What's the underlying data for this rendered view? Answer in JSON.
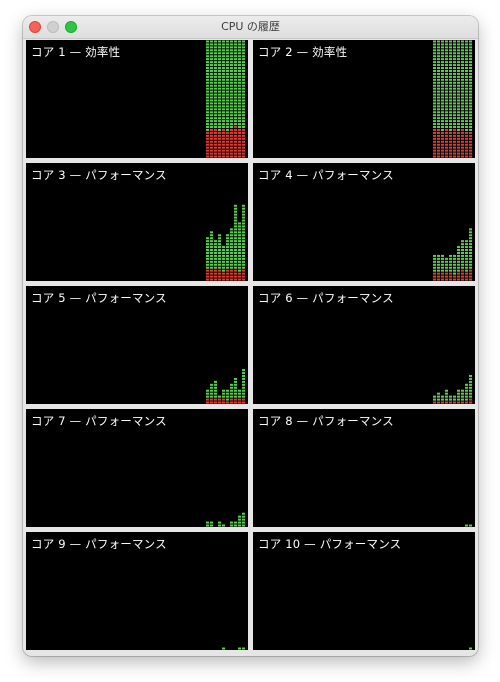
{
  "window": {
    "title": "CPU の履歴"
  },
  "colors": {
    "background": "#000000",
    "user_load": "#58d14a",
    "system_load": "#e33b2f",
    "label_text": "#ffffff"
  },
  "cores": [
    {
      "label": "コア 1 — 効率性",
      "history": [
        {
          "system": 0.23,
          "user": 0.77
        },
        {
          "system": 0.25,
          "user": 0.75
        },
        {
          "system": 0.24,
          "user": 0.76
        },
        {
          "system": 0.23,
          "user": 0.77
        },
        {
          "system": 0.25,
          "user": 0.75
        },
        {
          "system": 0.23,
          "user": 0.77
        },
        {
          "system": 0.24,
          "user": 0.76
        },
        {
          "system": 0.27,
          "user": 0.73
        },
        {
          "system": 0.26,
          "user": 0.74
        },
        {
          "system": 0.25,
          "user": 0.75
        }
      ]
    },
    {
      "label": "コア 2 — 効率性",
      "history": [
        {
          "system": 0.24,
          "user": 0.76
        },
        {
          "system": 0.24,
          "user": 0.76
        },
        {
          "system": 0.22,
          "user": 0.78
        },
        {
          "system": 0.25,
          "user": 0.75
        },
        {
          "system": 0.23,
          "user": 0.77
        },
        {
          "system": 0.24,
          "user": 0.76
        },
        {
          "system": 0.23,
          "user": 0.77
        },
        {
          "system": 0.26,
          "user": 0.74
        },
        {
          "system": 0.22,
          "user": 0.78
        },
        {
          "system": 0.22,
          "user": 0.78
        }
      ]
    },
    {
      "label": "コア 3 — パフォーマンス",
      "history": [
        {
          "system": 0.1,
          "user": 0.27
        },
        {
          "system": 0.09,
          "user": 0.32
        },
        {
          "system": 0.1,
          "user": 0.24
        },
        {
          "system": 0.09,
          "user": 0.3
        },
        {
          "system": 0.08,
          "user": 0.22
        },
        {
          "system": 0.1,
          "user": 0.3
        },
        {
          "system": 0.11,
          "user": 0.35
        },
        {
          "system": 0.09,
          "user": 0.54
        },
        {
          "system": 0.08,
          "user": 0.43
        },
        {
          "system": 0.1,
          "user": 0.56
        }
      ]
    },
    {
      "label": "コア 4 — パフォーマンス",
      "history": [
        {
          "system": 0.08,
          "user": 0.14
        },
        {
          "system": 0.07,
          "user": 0.15
        },
        {
          "system": 0.08,
          "user": 0.14
        },
        {
          "system": 0.07,
          "user": 0.13
        },
        {
          "system": 0.08,
          "user": 0.15
        },
        {
          "system": 0.06,
          "user": 0.18
        },
        {
          "system": 0.08,
          "user": 0.22
        },
        {
          "system": 0.09,
          "user": 0.24
        },
        {
          "system": 0.07,
          "user": 0.28
        },
        {
          "system": 0.09,
          "user": 0.36
        }
      ]
    },
    {
      "label": "コア 5 — パフォーマンス",
      "history": [
        {
          "system": 0.05,
          "user": 0.08
        },
        {
          "system": 0.04,
          "user": 0.12
        },
        {
          "system": 0.05,
          "user": 0.14
        },
        {
          "system": 0.04,
          "user": 0.03
        },
        {
          "system": 0.05,
          "user": 0.07
        },
        {
          "system": 0.03,
          "user": 0.1
        },
        {
          "system": 0.04,
          "user": 0.13
        },
        {
          "system": 0.05,
          "user": 0.17
        },
        {
          "system": 0.04,
          "user": 0.08
        },
        {
          "system": 0.05,
          "user": 0.26
        }
      ]
    },
    {
      "label": "コア 6 — パフォーマンス",
      "history": [
        {
          "system": 0.03,
          "user": 0.06
        },
        {
          "system": 0.02,
          "user": 0.08
        },
        {
          "system": 0.03,
          "user": 0.04
        },
        {
          "system": 0.02,
          "user": 0.09
        },
        {
          "system": 0.03,
          "user": 0.05
        },
        {
          "system": 0.02,
          "user": 0.06
        },
        {
          "system": 0.03,
          "user": 0.1
        },
        {
          "system": 0.02,
          "user": 0.09
        },
        {
          "system": 0.03,
          "user": 0.14
        },
        {
          "system": 0.04,
          "user": 0.21
        }
      ]
    },
    {
      "label": "コア 7 — パフォーマンス",
      "history": [
        {
          "system": 0.0,
          "user": 0.05
        },
        {
          "system": 0.0,
          "user": 0.06
        },
        {
          "system": 0.0,
          "user": 0.0
        },
        {
          "system": 0.0,
          "user": 0.04
        },
        {
          "system": 0.0,
          "user": 0.03
        },
        {
          "system": 0.0,
          "user": 0.0
        },
        {
          "system": 0.0,
          "user": 0.05
        },
        {
          "system": 0.0,
          "user": 0.06
        },
        {
          "system": 0.0,
          "user": 0.09
        },
        {
          "system": 0.0,
          "user": 0.13
        }
      ]
    },
    {
      "label": "コア 8 — パフォーマンス",
      "history": [
        {
          "system": 0.0,
          "user": 0.0
        },
        {
          "system": 0.0,
          "user": 0.0
        },
        {
          "system": 0.0,
          "user": 0.0
        },
        {
          "system": 0.0,
          "user": 0.0
        },
        {
          "system": 0.0,
          "user": 0.0
        },
        {
          "system": 0.0,
          "user": 0.0
        },
        {
          "system": 0.0,
          "user": 0.0
        },
        {
          "system": 0.0,
          "user": 0.0
        },
        {
          "system": 0.0,
          "user": 0.03
        },
        {
          "system": 0.0,
          "user": 0.03
        }
      ]
    },
    {
      "label": "コア 9 — パフォーマンス",
      "history": [
        {
          "system": 0.0,
          "user": 0.0
        },
        {
          "system": 0.0,
          "user": 0.0
        },
        {
          "system": 0.0,
          "user": 0.0
        },
        {
          "system": 0.0,
          "user": 0.0
        },
        {
          "system": 0.0,
          "user": 0.02
        },
        {
          "system": 0.0,
          "user": 0.0
        },
        {
          "system": 0.0,
          "user": 0.0
        },
        {
          "system": 0.0,
          "user": 0.0
        },
        {
          "system": 0.0,
          "user": 0.02
        },
        {
          "system": 0.0,
          "user": 0.02
        }
      ]
    },
    {
      "label": "コア 10 — パフォーマンス",
      "history": [
        {
          "system": 0.0,
          "user": 0.0
        },
        {
          "system": 0.0,
          "user": 0.0
        },
        {
          "system": 0.0,
          "user": 0.0
        },
        {
          "system": 0.0,
          "user": 0.0
        },
        {
          "system": 0.0,
          "user": 0.0
        },
        {
          "system": 0.0,
          "user": 0.0
        },
        {
          "system": 0.0,
          "user": 0.0
        },
        {
          "system": 0.0,
          "user": 0.0
        },
        {
          "system": 0.0,
          "user": 0.0
        },
        {
          "system": 0.0,
          "user": 0.02
        }
      ]
    }
  ]
}
